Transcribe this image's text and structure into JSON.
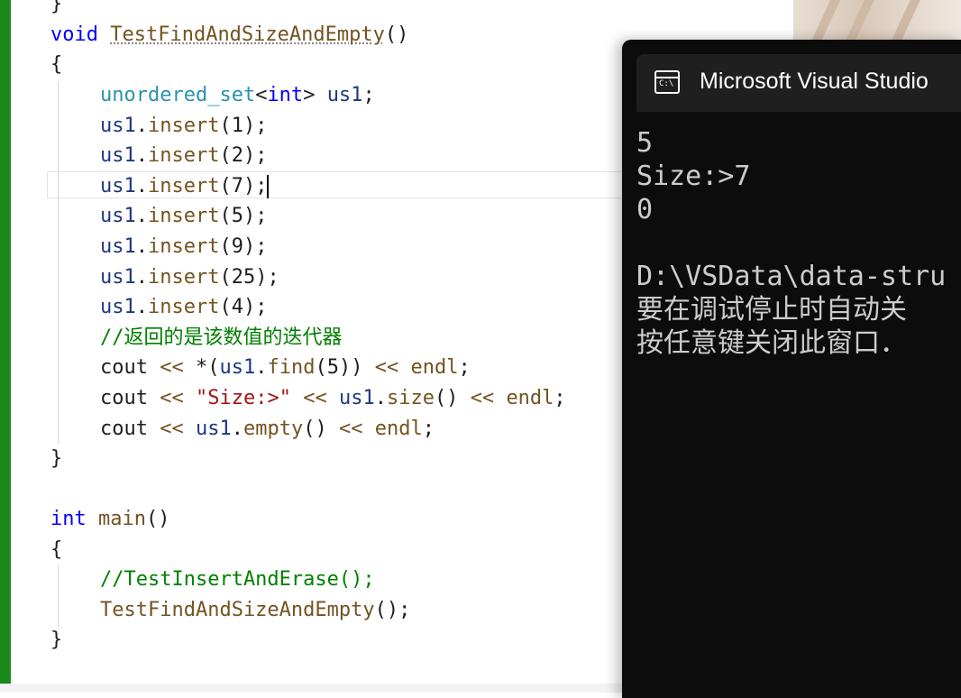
{
  "editor": {
    "lines": [
      {
        "parts": [
          {
            "c": "pl",
            "t": "}"
          }
        ]
      },
      {
        "parts": [
          {
            "c": "kw",
            "t": "void"
          },
          {
            "c": "pl",
            "t": " "
          },
          {
            "c": "fn sq",
            "t": "TestFindAndSizeAndEmpty"
          },
          {
            "c": "pl",
            "t": "()"
          }
        ]
      },
      {
        "parts": [
          {
            "c": "pl",
            "t": "{"
          }
        ]
      },
      {
        "indent": 1,
        "parts": [
          {
            "c": "ty",
            "t": "unordered_set"
          },
          {
            "c": "pl",
            "t": "<"
          },
          {
            "c": "kw",
            "t": "int"
          },
          {
            "c": "pl",
            "t": "> "
          },
          {
            "c": "id",
            "t": "us1"
          },
          {
            "c": "pl",
            "t": ";"
          }
        ]
      },
      {
        "indent": 1,
        "parts": [
          {
            "c": "id",
            "t": "us1"
          },
          {
            "c": "pl",
            "t": "."
          },
          {
            "c": "fn",
            "t": "insert"
          },
          {
            "c": "pl",
            "t": "(1);"
          }
        ]
      },
      {
        "indent": 1,
        "parts": [
          {
            "c": "id",
            "t": "us1"
          },
          {
            "c": "pl",
            "t": "."
          },
          {
            "c": "fn",
            "t": "insert"
          },
          {
            "c": "pl",
            "t": "(2);"
          }
        ]
      },
      {
        "indent": 1,
        "caret": true,
        "parts": [
          {
            "c": "id",
            "t": "us1"
          },
          {
            "c": "pl",
            "t": "."
          },
          {
            "c": "fn",
            "t": "insert"
          },
          {
            "c": "pl",
            "t": "(7);"
          }
        ]
      },
      {
        "indent": 1,
        "parts": [
          {
            "c": "id",
            "t": "us1"
          },
          {
            "c": "pl",
            "t": "."
          },
          {
            "c": "fn",
            "t": "insert"
          },
          {
            "c": "pl",
            "t": "(5);"
          }
        ]
      },
      {
        "indent": 1,
        "parts": [
          {
            "c": "id",
            "t": "us1"
          },
          {
            "c": "pl",
            "t": "."
          },
          {
            "c": "fn",
            "t": "insert"
          },
          {
            "c": "pl",
            "t": "(9);"
          }
        ]
      },
      {
        "indent": 1,
        "parts": [
          {
            "c": "id",
            "t": "us1"
          },
          {
            "c": "pl",
            "t": "."
          },
          {
            "c": "fn",
            "t": "insert"
          },
          {
            "c": "pl",
            "t": "(25);"
          }
        ]
      },
      {
        "indent": 1,
        "parts": [
          {
            "c": "id",
            "t": "us1"
          },
          {
            "c": "pl",
            "t": "."
          },
          {
            "c": "fn",
            "t": "insert"
          },
          {
            "c": "pl",
            "t": "(4);"
          }
        ]
      },
      {
        "indent": 1,
        "parts": [
          {
            "c": "cm",
            "t": "//返回的是该数值的迭代器"
          }
        ]
      },
      {
        "indent": 1,
        "parts": [
          {
            "c": "pl",
            "t": "cout "
          },
          {
            "c": "fn",
            "t": "<<"
          },
          {
            "c": "pl",
            "t": " *("
          },
          {
            "c": "id",
            "t": "us1"
          },
          {
            "c": "pl",
            "t": "."
          },
          {
            "c": "fn",
            "t": "find"
          },
          {
            "c": "pl",
            "t": "(5)) "
          },
          {
            "c": "fn",
            "t": "<<"
          },
          {
            "c": "pl",
            "t": " "
          },
          {
            "c": "fn",
            "t": "endl"
          },
          {
            "c": "pl",
            "t": ";"
          }
        ]
      },
      {
        "indent": 1,
        "parts": [
          {
            "c": "pl",
            "t": "cout "
          },
          {
            "c": "fn",
            "t": "<<"
          },
          {
            "c": "pl",
            "t": " "
          },
          {
            "c": "st",
            "t": "\"Size:>\""
          },
          {
            "c": "pl",
            "t": " "
          },
          {
            "c": "fn",
            "t": "<<"
          },
          {
            "c": "pl",
            "t": " "
          },
          {
            "c": "id",
            "t": "us1"
          },
          {
            "c": "pl",
            "t": "."
          },
          {
            "c": "fn",
            "t": "size"
          },
          {
            "c": "pl",
            "t": "() "
          },
          {
            "c": "fn",
            "t": "<<"
          },
          {
            "c": "pl",
            "t": " "
          },
          {
            "c": "fn",
            "t": "endl"
          },
          {
            "c": "pl",
            "t": ";"
          }
        ]
      },
      {
        "indent": 1,
        "parts": [
          {
            "c": "pl",
            "t": "cout "
          },
          {
            "c": "fn",
            "t": "<<"
          },
          {
            "c": "pl",
            "t": " "
          },
          {
            "c": "id",
            "t": "us1"
          },
          {
            "c": "pl",
            "t": "."
          },
          {
            "c": "fn",
            "t": "empty"
          },
          {
            "c": "pl",
            "t": "() "
          },
          {
            "c": "fn",
            "t": "<<"
          },
          {
            "c": "pl",
            "t": " "
          },
          {
            "c": "fn",
            "t": "endl"
          },
          {
            "c": "pl",
            "t": ";"
          }
        ]
      },
      {
        "parts": [
          {
            "c": "pl",
            "t": "}"
          }
        ]
      },
      {
        "parts": []
      },
      {
        "parts": [
          {
            "c": "kw",
            "t": "int"
          },
          {
            "c": "pl",
            "t": " "
          },
          {
            "c": "fn",
            "t": "main"
          },
          {
            "c": "pl",
            "t": "()"
          }
        ]
      },
      {
        "parts": [
          {
            "c": "pl",
            "t": "{"
          }
        ]
      },
      {
        "indent": 1,
        "parts": [
          {
            "c": "cm",
            "t": "//TestInsertAndErase();"
          }
        ]
      },
      {
        "indent": 1,
        "parts": [
          {
            "c": "fn",
            "t": "TestFindAndSizeAndEmpty"
          },
          {
            "c": "pl",
            "t": "();"
          }
        ]
      },
      {
        "parts": [
          {
            "c": "pl",
            "t": "}"
          }
        ]
      }
    ]
  },
  "console": {
    "title": "Microsoft Visual Studio",
    "icon": "terminal-icon",
    "icon_text": "C:\\",
    "output": "5\nSize:>7\n0\n\nD:\\VSData\\data-stru\n要在调试停止时自动关\n按任意键关闭此窗口．"
  },
  "colors": {
    "keyword": "#0000ff",
    "function": "#74531f",
    "type": "#2b91af",
    "identifier": "#1f377f",
    "comment": "#008000",
    "string": "#a31515",
    "change_bar": "#1a8a1a",
    "console_bg": "#0c0c0c"
  }
}
